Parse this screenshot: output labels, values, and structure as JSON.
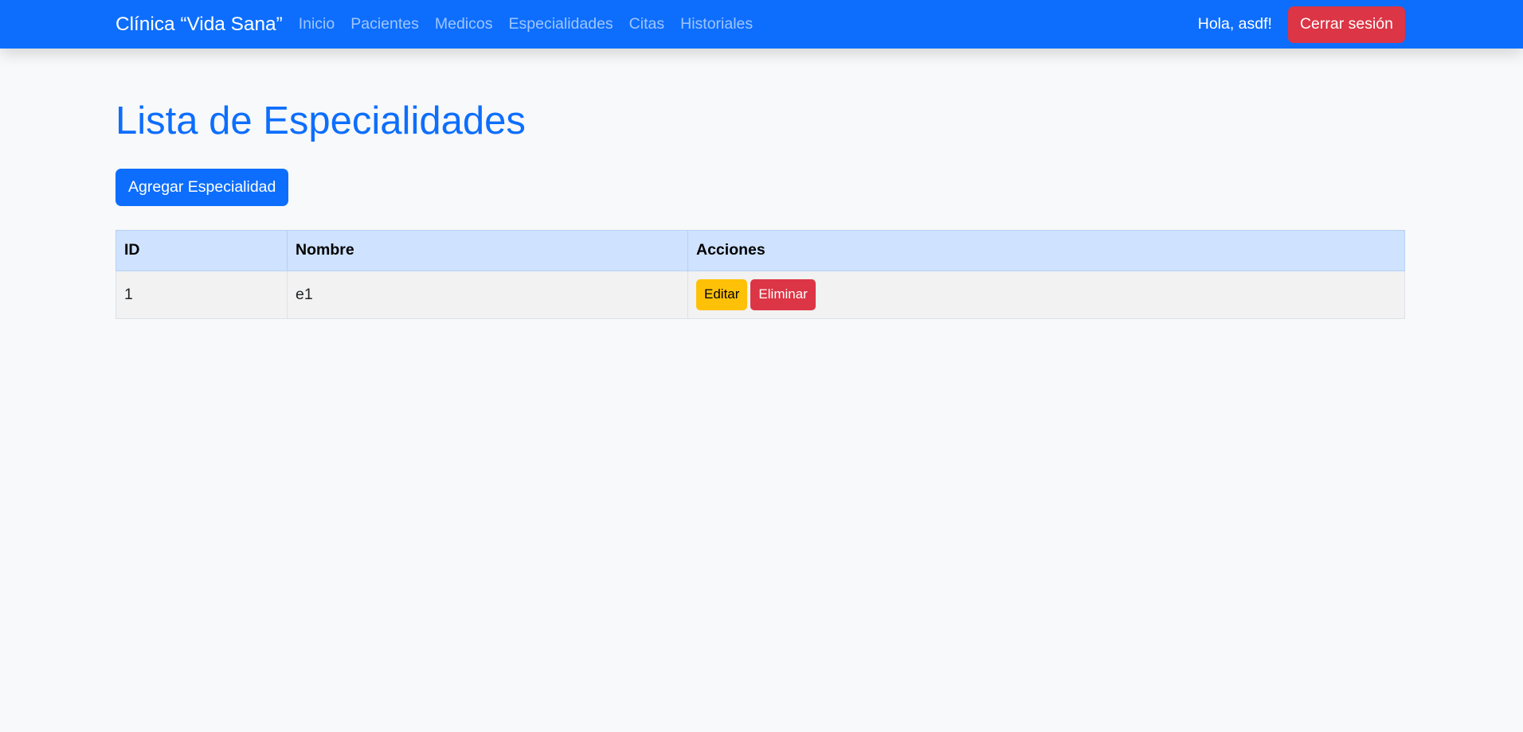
{
  "navbar": {
    "brand": "Clínica “Vida Sana”",
    "links": [
      "Inicio",
      "Pacientes",
      "Medicos",
      "Especialidades",
      "Citas",
      "Historiales"
    ],
    "greeting": "Hola, asdf!",
    "logout": "Cerrar sesión"
  },
  "page": {
    "title": "Lista de Especialidades",
    "add_button": "Agregar Especialidad"
  },
  "table": {
    "headers": [
      "ID",
      "Nombre",
      "Acciones"
    ],
    "rows": [
      {
        "id": "1",
        "nombre": "e1",
        "edit": "Editar",
        "delete": "Eliminar"
      }
    ]
  }
}
